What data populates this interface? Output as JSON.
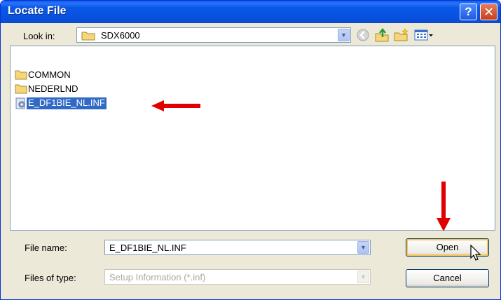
{
  "window": {
    "title": "Locate File",
    "help_glyph": "?",
    "close_glyph": "✕"
  },
  "look_in": {
    "label": "Look in:",
    "value": "SDX6000",
    "icon": "folder-icon"
  },
  "toolbar": {
    "icons": [
      "back-icon",
      "up-folder-icon",
      "new-folder-icon",
      "view-menu-icon"
    ]
  },
  "files": [
    {
      "name": "COMMON",
      "type": "folder"
    },
    {
      "name": "NEDERLND",
      "type": "folder"
    },
    {
      "name": "E_DF1BIE_NL.INF",
      "type": "setup-file",
      "selected": true
    }
  ],
  "file_name": {
    "label": "File name:",
    "value": "E_DF1BIE_NL.INF"
  },
  "file_type": {
    "label": "Files of type:",
    "value": "Setup Information (*.inf)",
    "disabled": true
  },
  "buttons": {
    "open": "Open",
    "cancel": "Cancel"
  },
  "annotations": [
    "red-arrow-right",
    "red-arrow-down"
  ],
  "colors": {
    "titlebar": "#0858e8",
    "selection": "#316ac5",
    "arrow": "#e00000",
    "dialog_bg": "#ece9d8"
  }
}
